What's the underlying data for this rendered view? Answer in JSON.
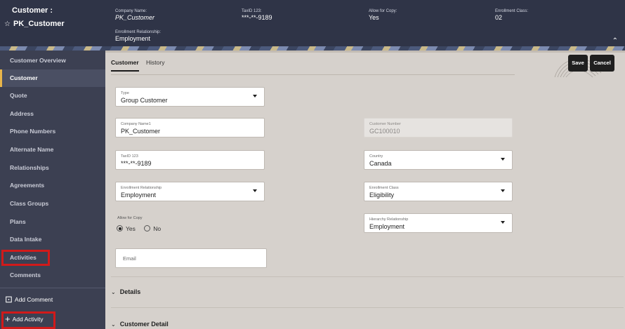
{
  "header": {
    "customer_label": "Customer :",
    "customer_name": "PK_Customer",
    "fields": [
      {
        "label": "Company Name:",
        "value": "PK_Customer",
        "italic": true
      },
      {
        "label": "TaxID 123:",
        "value": "***-**-9189"
      },
      {
        "label": "Allow for Copy:",
        "value": "Yes"
      },
      {
        "label": "Enrollment Class:",
        "value": "02"
      },
      {
        "label": "Enrollment Relationship:",
        "value": "Employment"
      }
    ]
  },
  "sidebar": {
    "items": [
      {
        "label": "Customer Overview"
      },
      {
        "label": "Customer"
      },
      {
        "label": "Quote"
      },
      {
        "label": "Address"
      },
      {
        "label": "Phone Numbers"
      },
      {
        "label": "Alternate Name"
      },
      {
        "label": "Relationships"
      },
      {
        "label": "Agreements"
      },
      {
        "label": "Class Groups"
      },
      {
        "label": "Plans"
      },
      {
        "label": "Data Intake"
      },
      {
        "label": "Activities"
      },
      {
        "label": "Comments"
      }
    ],
    "add_comment": "Add Comment",
    "add_activity": "Add Activity"
  },
  "tabs": [
    {
      "label": "Customer"
    },
    {
      "label": "History"
    }
  ],
  "buttons": {
    "save": "Save",
    "cancel": "Cancel"
  },
  "form": {
    "type": {
      "label": "Type",
      "value": "Group Customer"
    },
    "company_name": {
      "label": "Company Name1",
      "value": "PK_Customer"
    },
    "customer_number": {
      "label": "Customer Number",
      "value": "GC100010"
    },
    "taxid": {
      "label": "TaxID 123",
      "value": "***-**-9189"
    },
    "country": {
      "label": "Country",
      "value": "Canada"
    },
    "enrollment_relationship": {
      "label": "Enrollment Relationship",
      "value": "Employment"
    },
    "enrollment_class": {
      "label": "Enrollment Class",
      "value": "Eligibility"
    },
    "allow_for_copy": {
      "label": "Allow for Copy",
      "options": [
        "Yes",
        "No"
      ],
      "selected": "Yes"
    },
    "hierarchy_relationship": {
      "label": "Hierarchy Relationship",
      "value": "Employment"
    },
    "email": {
      "placeholder": "Email"
    }
  },
  "sections": {
    "details": "Details",
    "customer_detail": "Customer Detail"
  },
  "colors": {
    "header_bg": "#2f3447",
    "sidebar_bg": "#3c4052",
    "highlight_red": "#d11a1a",
    "active_accent": "#e8b54a"
  }
}
